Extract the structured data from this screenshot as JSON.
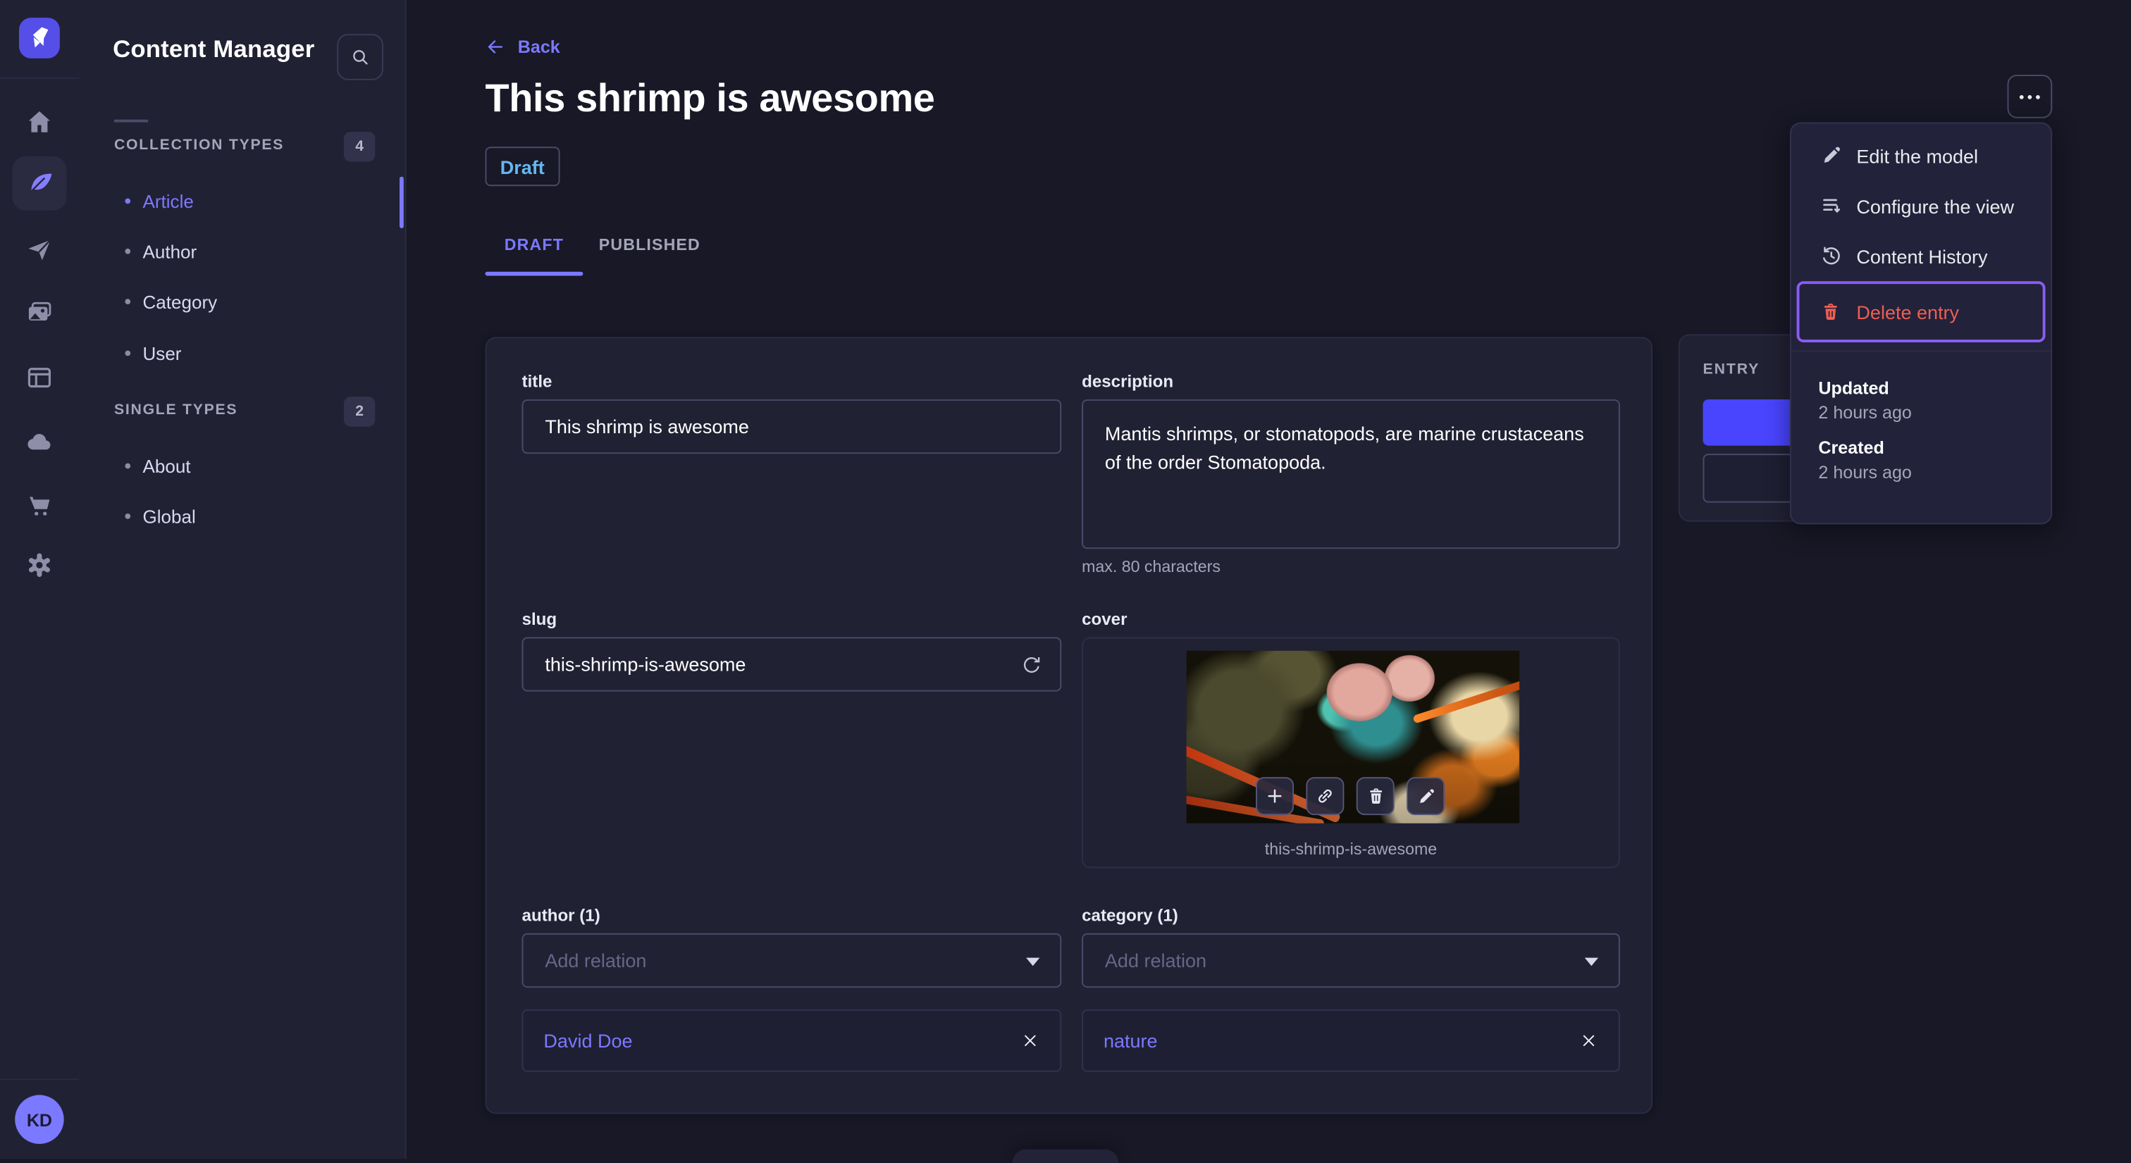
{
  "app": {
    "avatar_initials": "KD"
  },
  "sidebar": {
    "title": "Content Manager",
    "sections": [
      {
        "label": "COLLECTION TYPES",
        "count": "4",
        "items": [
          {
            "label": "Article",
            "active": true
          },
          {
            "label": "Author"
          },
          {
            "label": "Category"
          },
          {
            "label": "User"
          }
        ]
      },
      {
        "label": "SINGLE TYPES",
        "count": "2",
        "items": [
          {
            "label": "About"
          },
          {
            "label": "Global"
          }
        ]
      }
    ]
  },
  "header": {
    "back_label": "Back",
    "title": "This shrimp is awesome",
    "status_badge": "Draft",
    "tabs": [
      {
        "label": "DRAFT",
        "active": true
      },
      {
        "label": "PUBLISHED"
      }
    ]
  },
  "form": {
    "title": {
      "label": "title",
      "value": "This shrimp is awesome"
    },
    "description": {
      "label": "description",
      "value": "Mantis shrimps, or stomatopods, are marine crustaceans of the order Stomatopoda.",
      "hint": "max. 80 characters"
    },
    "slug": {
      "label": "slug",
      "value": "this-shrimp-is-awesome"
    },
    "cover": {
      "label": "cover",
      "caption": "this-shrimp-is-awesome"
    },
    "author": {
      "label": "author (1)",
      "placeholder": "Add relation",
      "relation": "David Doe"
    },
    "category": {
      "label": "category (1)",
      "placeholder": "Add relation",
      "relation": "nature"
    }
  },
  "entry_panel": {
    "title": "ENTRY"
  },
  "menu": {
    "items": [
      {
        "label": "Edit the model"
      },
      {
        "label": "Configure the view"
      },
      {
        "label": "Content History"
      },
      {
        "label": "Delete entry",
        "danger": true
      }
    ],
    "meta": [
      {
        "label": "Updated",
        "value": "2 hours ago"
      },
      {
        "label": "Created",
        "value": "2 hours ago"
      }
    ]
  },
  "colors": {
    "accent": "#7b79ff",
    "primary_button": "#4945ff",
    "danger": "#ee5e52",
    "draft_text": "#66b7f1",
    "focus_ring": "#8a5cf5"
  }
}
